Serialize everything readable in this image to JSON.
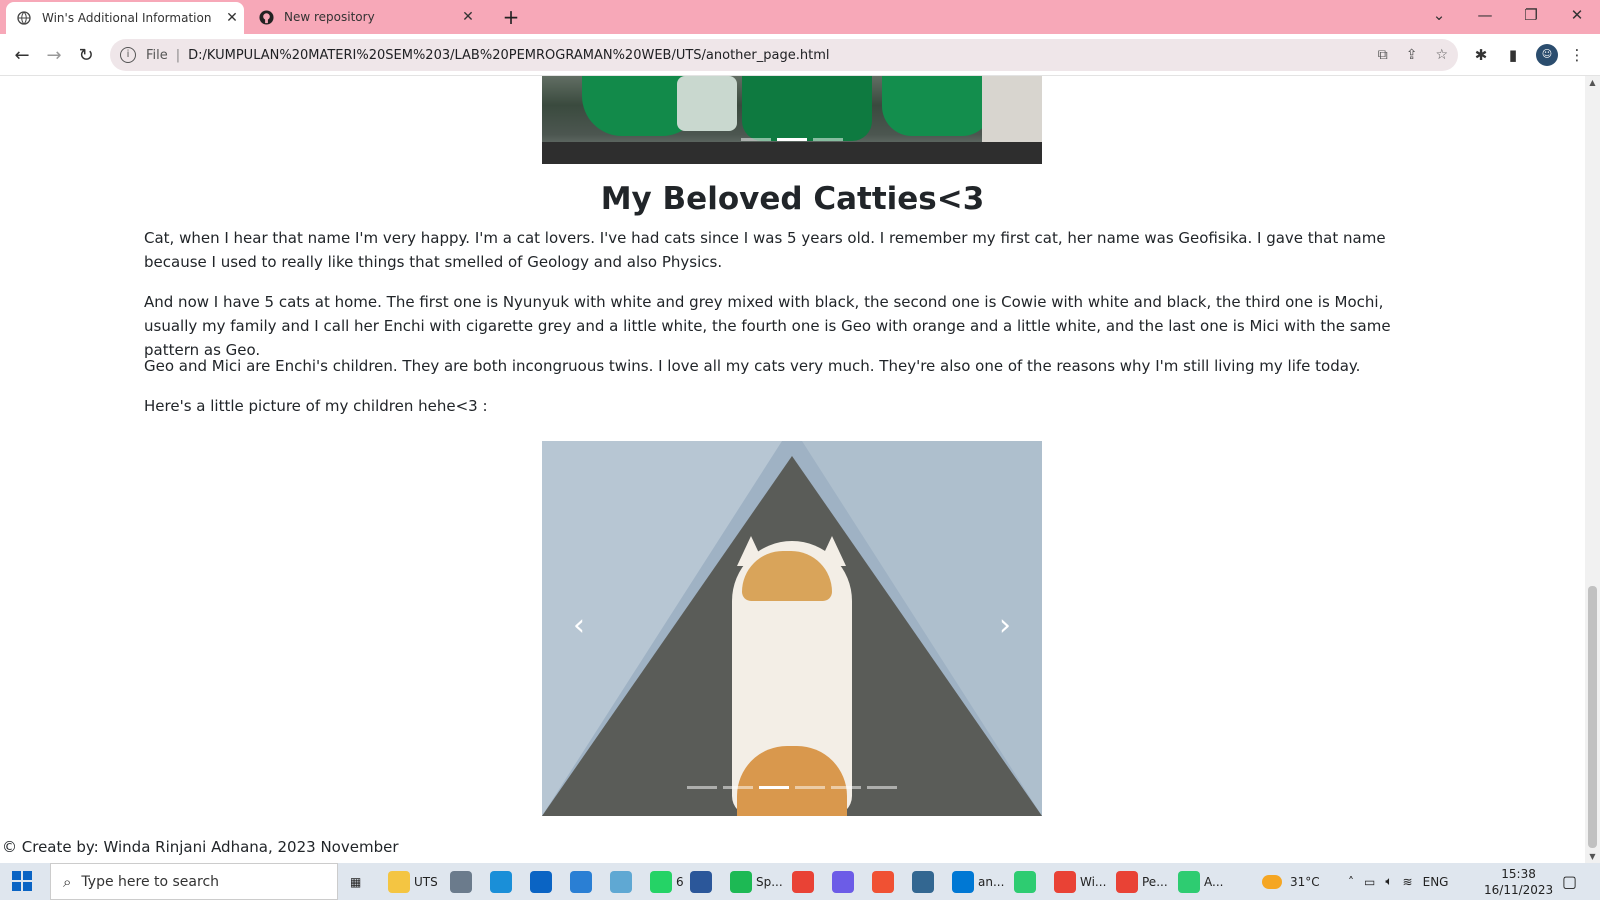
{
  "browser": {
    "tabs": [
      {
        "title": "Win's Additional Information",
        "active": true
      },
      {
        "title": "New repository",
        "active": false
      }
    ],
    "new_tab": "+",
    "address": {
      "scheme_label": "File",
      "url": "D:/KUMPULAN%20MATERI%20SEM%203/LAB%20PEMROGRAMAN%20WEB/UTS/another_page.html"
    }
  },
  "page": {
    "heading": "My Beloved Catties<3",
    "paragraphs": [
      "Cat, when I hear that name I'm very happy. I'm a cat lovers. I've had cats since I was 5 years old. I remember my first cat, her name was Geofisika. I gave that name because I used to really like things that smelled of Geology and also Physics.",
      "And now I have 5 cats at home. The first one is Nyunyuk with white and grey mixed with black, the second one is Cowie with white and black, the third one is Mochi, usually my family and I call her Enchi with cigarette grey and a little white, the fourth one is Geo with orange and a little white, and the last one is Mici with the same pattern as Geo.",
      "Geo and Mici are Enchi's children. They are both incongruous twins. I love all my cats very much. They're also one of the reasons why I'm still living my life today.",
      "Here's a little picture of my children hehe<3 :"
    ],
    "carousel_top": {
      "indicators": 3,
      "active_index": 1
    },
    "carousel_cats": {
      "indicators": 6,
      "active_index": 2,
      "prev_icon": "‹",
      "next_icon": "›"
    },
    "footer": "© Create by: Winda Rinjani Adhana, 2023 November"
  },
  "taskbar": {
    "search_placeholder": "Type here to search",
    "apps": [
      {
        "label": "UTS",
        "icon": "folder-icon",
        "color": "#f4c542"
      },
      {
        "label": "",
        "icon": "camera-icon",
        "color": "#6b7b8c"
      },
      {
        "label": "",
        "icon": "edge-icon",
        "color": "#1a8fd8"
      },
      {
        "label": "",
        "icon": "mail-icon",
        "color": "#0a64c4"
      },
      {
        "label": "",
        "icon": "store-icon",
        "color": "#2a7fd4"
      },
      {
        "label": "",
        "icon": "notes-icon",
        "color": "#5fa8d3"
      },
      {
        "label": "6",
        "icon": "whatsapp-icon",
        "color": "#25d366"
      },
      {
        "label": "",
        "icon": "word-icon",
        "color": "#2b579a"
      },
      {
        "label": "Sp...",
        "icon": "spotify-icon",
        "color": "#1db954"
      },
      {
        "label": "",
        "icon": "chrome-icon",
        "color": "#e94235"
      },
      {
        "label": "",
        "icon": "app-icon",
        "color": "#6c5ce7"
      },
      {
        "label": "",
        "icon": "git-icon",
        "color": "#f05133"
      },
      {
        "label": "",
        "icon": "db-icon",
        "color": "#336791"
      },
      {
        "label": "an...",
        "icon": "vscode-icon",
        "color": "#0078d4"
      },
      {
        "label": "",
        "icon": "loader-icon",
        "color": "#2ecc71"
      },
      {
        "label": "Wi...",
        "icon": "chrome-icon",
        "color": "#e94235"
      },
      {
        "label": "Pe...",
        "icon": "chrome-icon",
        "color": "#e94235"
      },
      {
        "label": "A...",
        "icon": "loader-icon",
        "color": "#2ecc71"
      }
    ],
    "weather": "31°C",
    "language": "ENG",
    "time": "15:38",
    "date": "16/11/2023"
  },
  "colors": {
    "tabbar": "#f7a8b8",
    "omnibox": "#efe6e9",
    "text": "#212529"
  }
}
